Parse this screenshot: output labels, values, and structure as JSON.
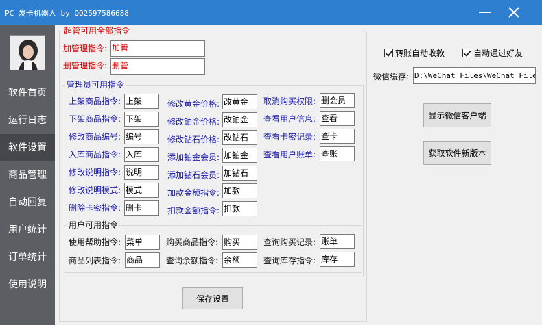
{
  "window": {
    "title": "PC 发卡机器人 by QQ2597586688",
    "minimize_icon": "minimize-icon",
    "close_icon": "close-icon"
  },
  "sidebar": {
    "avatar_icon": "user-avatar",
    "items": [
      {
        "label": "软件首页"
      },
      {
        "label": "运行日志"
      },
      {
        "label": "软件设置"
      },
      {
        "label": "商品管理"
      },
      {
        "label": "自动回复"
      },
      {
        "label": "用户统计"
      },
      {
        "label": "订单统计"
      },
      {
        "label": "使用说明"
      }
    ],
    "active_index": 2
  },
  "super_admin": {
    "title": "超管可用全部指令",
    "add_admin": {
      "label": "加管理指令:",
      "value": "加管"
    },
    "del_admin": {
      "label": "删管理指令:",
      "value": "删管"
    }
  },
  "admin": {
    "title": "管理员可用指令",
    "col1": [
      {
        "label": "上架商品指令:",
        "value": "上架"
      },
      {
        "label": "下架商品指令:",
        "value": "下架"
      },
      {
        "label": "修改商品编号:",
        "value": "编号"
      },
      {
        "label": "入库商品指令:",
        "value": "入库"
      },
      {
        "label": "修改说明指令:",
        "value": "说明"
      },
      {
        "label": "修改说明模式:",
        "value": "模式"
      },
      {
        "label": "删除卡密指令:",
        "value": "删卡"
      }
    ],
    "col2": [
      {
        "label": "修改黄金价格:",
        "value": "改黄金"
      },
      {
        "label": "修改铂金价格:",
        "value": "改铂金"
      },
      {
        "label": "修改钻石价格:",
        "value": "改钻石"
      },
      {
        "label": "添加铂金会员:",
        "value": "加铂金"
      },
      {
        "label": "添加钻石会员:",
        "value": "加钻石"
      },
      {
        "label": "加款金额指令:",
        "value": "加款"
      },
      {
        "label": "扣款金额指令:",
        "value": "扣款"
      }
    ],
    "col3": [
      {
        "label": "取消购买权限:",
        "value": "删会员"
      },
      {
        "label": "查看用户信息:",
        "value": "查看"
      },
      {
        "label": "查看卡密记录:",
        "value": "查卡"
      },
      {
        "label": "查看用户账单:",
        "value": "查账"
      }
    ]
  },
  "user": {
    "title": "用户可用指令",
    "col1": [
      {
        "label": "使用帮助指令:",
        "value": "菜单"
      },
      {
        "label": "商品列表指令:",
        "value": "商品"
      }
    ],
    "col2": [
      {
        "label": "购买商品指令:",
        "value": "购买"
      },
      {
        "label": "查询余额指令:",
        "value": "余额"
      }
    ],
    "col3": [
      {
        "label": "查询购买记录:",
        "value": "账单"
      },
      {
        "label": "查询库存指令:",
        "value": "库存"
      }
    ]
  },
  "right": {
    "transfer_auto_receive": {
      "label": "转账自动收款",
      "checked": true
    },
    "auto_accept_friend": {
      "label": "自动通过好友",
      "checked": true
    },
    "wechat_cache": {
      "label": "微信缓存:",
      "value": "D:\\WeChat Files\\WeChat Files"
    },
    "show_client_button": "显示微信客户端",
    "get_new_version_button": "获取软件新版本"
  },
  "save_button": "保存设置"
}
